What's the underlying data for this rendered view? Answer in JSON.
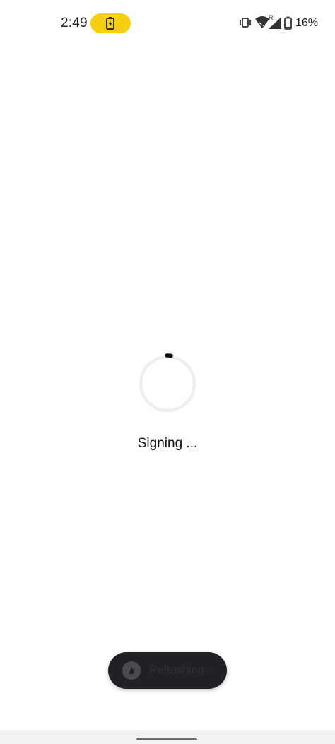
{
  "status_bar": {
    "time": "2:49",
    "battery_percent": "16%",
    "network_badge_r": "R",
    "wifi_badge": "6",
    "charging_pill_color": "#f7cf12",
    "icons": [
      "battery-charging-icon",
      "vibrate-icon",
      "wifi-icon",
      "signal-icon",
      "battery-icon"
    ]
  },
  "loading": {
    "message": "Signing ..."
  },
  "toast": {
    "message": "Refreshing...",
    "icon": "app-logo-icon"
  },
  "nav": {
    "handle": "home-gesture-handle"
  }
}
